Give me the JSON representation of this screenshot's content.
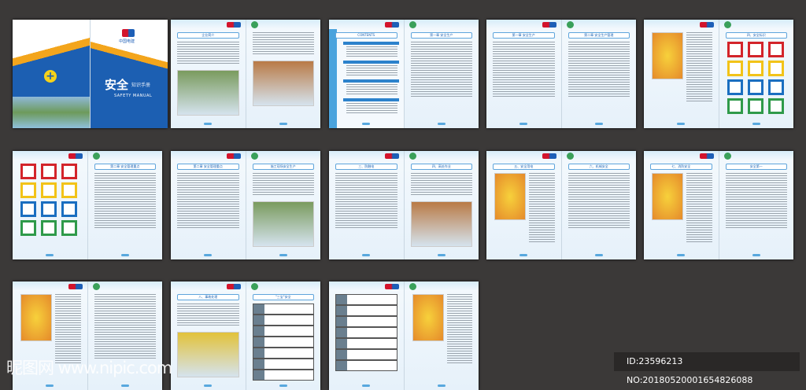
{
  "cover": {
    "logo_text": "中国电建",
    "title": "安全",
    "subtitle": "知识手册",
    "english": "SAFETY MANUAL"
  },
  "spreads": [
    {
      "left": {
        "title": "企业简介",
        "kind": "photo"
      },
      "right": {
        "title": "",
        "kind": "map"
      }
    },
    {
      "left": {
        "title": "CONTENTS",
        "kind": "toc"
      },
      "right": {
        "title": "第一章 安全生产",
        "kind": "text"
      }
    },
    {
      "left": {
        "title": "第一章 安全生产",
        "kind": "text"
      },
      "right": {
        "title": "第二章 安全生产管理",
        "kind": "text"
      }
    },
    {
      "left": {
        "title": "",
        "kind": "cartoon"
      },
      "right": {
        "title": "四、安全标识",
        "kind": "signs"
      }
    },
    {
      "left": {
        "title": "",
        "kind": "signs"
      },
      "right": {
        "title": "第二章 安全管理重点",
        "kind": "text"
      }
    },
    {
      "left": {
        "title": "第二章 安全管理重点",
        "kind": "text"
      },
      "right": {
        "title": "施工现场安全生产",
        "kind": "photo"
      }
    },
    {
      "left": {
        "title": "三、防触电",
        "kind": "text"
      },
      "right": {
        "title": "四、高处作业",
        "kind": "photo"
      }
    },
    {
      "left": {
        "title": "五、安全用电",
        "kind": "cartoon"
      },
      "right": {
        "title": "六、机械安全",
        "kind": "text"
      }
    },
    {
      "left": {
        "title": "七、消防安全",
        "kind": "cartoon"
      },
      "right": {
        "title": "安全第一",
        "kind": "text"
      }
    },
    {
      "left": {
        "title": "",
        "kind": "cartoon"
      },
      "right": {
        "title": "",
        "kind": "text"
      }
    },
    {
      "left": {
        "title": "八、事故处理",
        "kind": "photo"
      },
      "right": {
        "title": "\"三宝\"安全",
        "kind": "table"
      }
    },
    {
      "left": {
        "title": "",
        "kind": "table"
      },
      "right": {
        "title": "",
        "kind": "cartoon"
      }
    }
  ],
  "watermark": {
    "site": "昵图网 www.nipic.com",
    "id": "ID:23596213 NO:20180520001654826088"
  }
}
